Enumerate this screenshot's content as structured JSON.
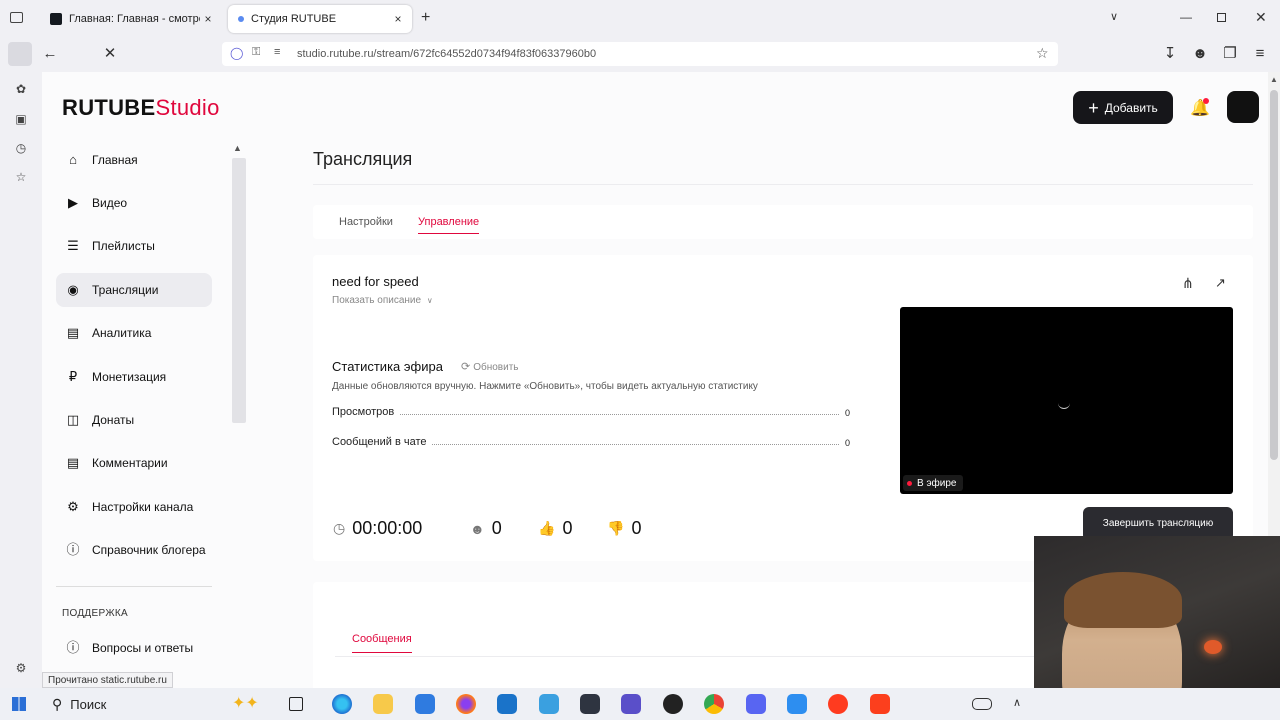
{
  "browser": {
    "tabs": [
      {
        "title": "Главная: Главная - смотреть о",
        "close": "×"
      },
      {
        "title": "Студия RUTUBE",
        "close": "×"
      }
    ],
    "new_tab": "+",
    "url": "studio.rutube.ru/stream/672fc64552d0734f94f83f06337960b0",
    "status_text": "Прочитано static.rutube.ru"
  },
  "header": {
    "logo_main": "RUTUBE",
    "logo_accent": "Studio",
    "add_button": "Добавить",
    "add_plus": "+"
  },
  "sidebar": {
    "items": [
      {
        "label": "Главная",
        "icon": "home-icon"
      },
      {
        "label": "Видео",
        "icon": "video-icon"
      },
      {
        "label": "Плейлисты",
        "icon": "playlist-icon"
      },
      {
        "label": "Трансляции",
        "icon": "broadcast-icon",
        "active": true
      },
      {
        "label": "Аналитика",
        "icon": "chart-icon"
      },
      {
        "label": "Монетизация",
        "icon": "ruble-icon"
      },
      {
        "label": "Донаты",
        "icon": "gift-icon"
      },
      {
        "label": "Комментарии",
        "icon": "comment-icon"
      },
      {
        "label": "Настройки канала",
        "icon": "gear-icon"
      },
      {
        "label": "Справочник блогера",
        "icon": "info-icon"
      }
    ],
    "support_heading": "ПОДДЕРЖКА",
    "support_items": [
      {
        "label": "Вопросы и ответы",
        "icon": "question-icon"
      }
    ]
  },
  "main": {
    "title": "Трансляция",
    "tabs": [
      {
        "label": "Настройки",
        "active": false
      },
      {
        "label": "Управление",
        "active": true
      }
    ],
    "stream": {
      "name": "need for speed",
      "show_description": "Показать описание",
      "stats_title": "Статистика эфира",
      "refresh": "Обновить",
      "stats_note": "Данные обновляются вручную. Нажмите «Обновить», чтобы видеть актуальную статистику",
      "stats": [
        {
          "label": "Просмотров",
          "value": "0"
        },
        {
          "label": "Сообщений в чате",
          "value": "0"
        }
      ],
      "live_badge": "В эфире",
      "end_button": "Завершить трансляцию",
      "counters": {
        "time": "00:00:00",
        "viewers": "0",
        "likes": "0",
        "dislikes": "0"
      }
    },
    "chat_tab": "Сообщения"
  },
  "taskbar": {
    "search": "Поиск"
  },
  "colors": {
    "accent": "#e0073d",
    "dark": "#111111",
    "live_red": "#ff1a3c"
  }
}
